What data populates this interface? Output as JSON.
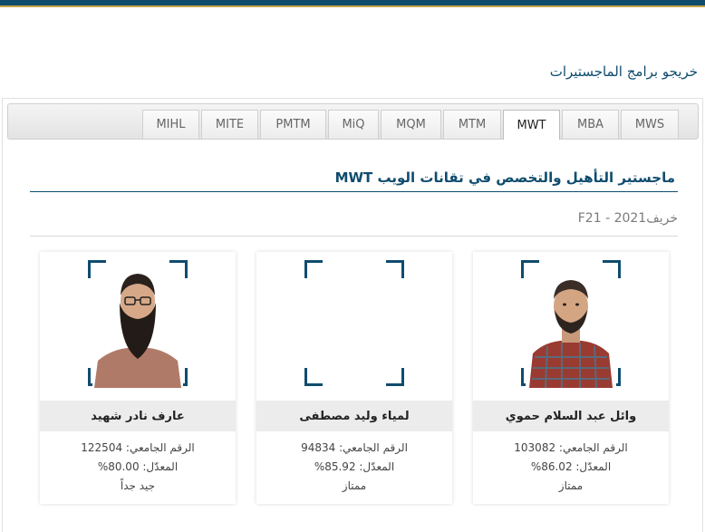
{
  "page": {
    "section_title": "خريجو برامج الماجستيرات"
  },
  "tabs": [
    {
      "label": "MIHL"
    },
    {
      "label": "MITE"
    },
    {
      "label": "PMTM"
    },
    {
      "label": "MiQ"
    },
    {
      "label": "MQM"
    },
    {
      "label": "MTM"
    },
    {
      "label": "MWT",
      "active": true
    },
    {
      "label": "MBA"
    },
    {
      "label": "MWS"
    }
  ],
  "program": {
    "title": "ماجستير التأهيل والتخصص في تقانات الويب MWT",
    "term": "خريف2021 - F21"
  },
  "graduates": [
    {
      "name": "وائل عبد السلام حموي",
      "id_line": "الرقم الجامعي: 103082",
      "gpa_line": "المعدّل: 86.02%",
      "grade": "ممتاز",
      "photo": "avatar-bald-beard"
    },
    {
      "name": "لمياء وليد مصطفى",
      "id_line": "الرقم الجامعي: 94834",
      "gpa_line": "المعدّل: 85.92%",
      "grade": "ممتاز",
      "photo": "none"
    },
    {
      "name": "عارف نادر شهيد",
      "id_line": "الرقم الجامعي: 122504",
      "gpa_line": "المعدّل: 80.00%",
      "grade": "جيد جداً",
      "photo": "avatar-glasses-beard"
    }
  ],
  "colors": {
    "brand": "#0f4c6e",
    "accent": "#c8a44a",
    "name_bar": "#ececec"
  }
}
